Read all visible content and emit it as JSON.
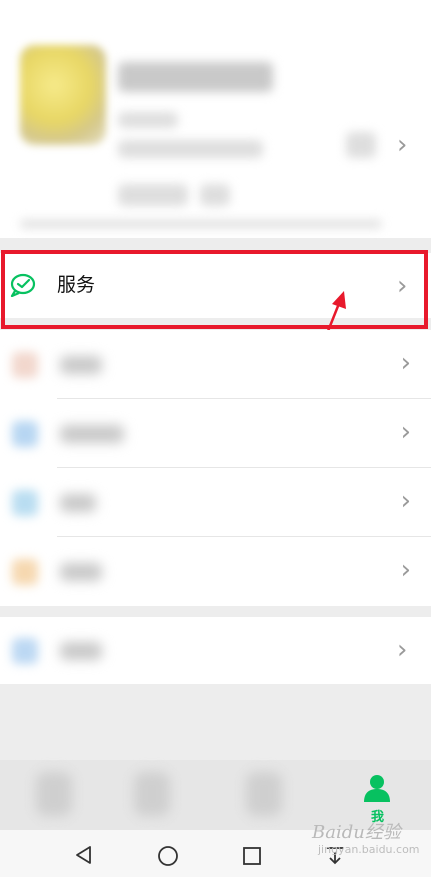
{
  "profile": {
    "name_blurred": "",
    "wechat_id_blurred": "",
    "status_blurred": ""
  },
  "services": {
    "icon": "wechat-pay-service-icon",
    "label": "服务",
    "accent": "#07c160",
    "highlight_color": "#e8192c"
  },
  "list_items": [
    {
      "icon": "favorites-icon",
      "label": ""
    },
    {
      "icon": "moments-icon",
      "label": ""
    },
    {
      "icon": "cards-icon",
      "label": ""
    },
    {
      "icon": "sticker-icon",
      "label": ""
    },
    {
      "icon": "settings-icon",
      "label": ""
    }
  ],
  "tabbar": {
    "tabs": [
      {
        "icon": "chats-icon",
        "label": ""
      },
      {
        "icon": "contacts-icon",
        "label": ""
      },
      {
        "icon": "discover-icon",
        "label": ""
      },
      {
        "icon": "me-icon",
        "label": "我"
      }
    ],
    "active_tab": 3
  },
  "system_nav": {
    "buttons": [
      "back-icon",
      "home-icon",
      "recents-icon",
      "notification-pull-icon"
    ]
  },
  "watermark": {
    "text": "Baidu经验",
    "subtext": "jingyan.baidu.com"
  }
}
